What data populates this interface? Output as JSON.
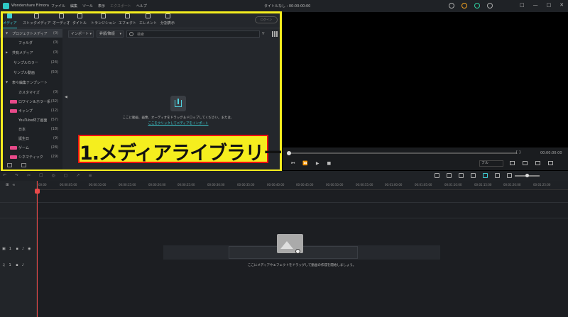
{
  "titlebar": {
    "app_title": "Wondershare Filmora",
    "menu": [
      "ファイル",
      "編集",
      "ツール",
      "表示",
      "エクスポート",
      "ヘルプ"
    ],
    "project": "タイトルなし : 00:00:00:00",
    "window_controls": [
      "—",
      "□",
      "✕"
    ]
  },
  "tabs": [
    {
      "label": "メディア",
      "icon": "media-icon"
    },
    {
      "label": "ストックメディア",
      "icon": "stock-media-icon"
    },
    {
      "label": "オーディオ",
      "icon": "audio-icon"
    },
    {
      "label": "タイトル",
      "icon": "title-icon"
    },
    {
      "label": "トランジション",
      "icon": "transition-icon"
    },
    {
      "label": "エフェクト",
      "icon": "effect-icon"
    },
    {
      "label": "エレメント",
      "icon": "element-icon"
    },
    {
      "label": "分割表示",
      "icon": "split-screen-icon"
    }
  ],
  "login_label": "ログイン",
  "sidebar": {
    "items": [
      {
        "label": "プロジェクトメディア",
        "count": "(0)",
        "caret": "▼",
        "selected": true
      },
      {
        "label": "フォルダ",
        "count": "(0)"
      },
      {
        "label": "共有メディア",
        "count": "(0)",
        "caret": "▶"
      },
      {
        "label": "サンプルカラー",
        "count": "(24)"
      },
      {
        "label": "サンプル動画",
        "count": "(50)"
      },
      {
        "label": "表々編集テンプレート",
        "count": "",
        "caret": "▼"
      },
      {
        "label": "カスタマイズ",
        "count": "(0)"
      },
      {
        "label": "ロワイン＆ホラー系",
        "count": "(32)",
        "badge": true
      },
      {
        "label": "キャンプ",
        "count": "(12)",
        "badge": true
      },
      {
        "label": "YouTube終了画面",
        "count": "(57)"
      },
      {
        "label": "日本",
        "count": "(18)"
      },
      {
        "label": "誕生日",
        "count": "(9)"
      },
      {
        "label": "ゲーム",
        "count": "(28)",
        "badge": true
      },
      {
        "label": "シネマティック",
        "count": "(29)",
        "badge": true
      }
    ]
  },
  "toolbar": {
    "import_label": "インポート",
    "sort_label": "昇順/降順",
    "search_placeholder": "検索"
  },
  "dropzone": {
    "text": "ここに動画、画像、オーディオをドラッグ＆ドロップしてください。または、",
    "link": "ここをクリックしてメディアをインポート"
  },
  "caption": "1.メディアライブラリー",
  "preview": {
    "braces": "{   }",
    "time": "00:00:00:00",
    "zoom": "フル",
    "buttons": [
      "⏮",
      "⏪",
      "▶",
      "■"
    ]
  },
  "timeline": {
    "left_tools": [
      "↶",
      "↷",
      "✂",
      "☐",
      "◎",
      "▢",
      "↗",
      "≡"
    ],
    "ruler_ticks": [
      "00:00",
      "00:00:05:00",
      "00:00:10:00",
      "00:00:15:00",
      "00:00:20:00",
      "00:00:25:00",
      "00:00:30:00",
      "00:00:35:00",
      "00:00:40:00",
      "00:00:45:00",
      "00:00:50:00",
      "00:00:55:00",
      "00:01:00:00",
      "00:01:05:00",
      "00:01:10:00",
      "00:01:15:00",
      "00:01:20:00",
      "00:01:25:00"
    ],
    "video_track": "1",
    "audio_track": "1",
    "drop_text": "ここにメディアやエフェクトをドラッグして動画の作成を開始しましょう。"
  },
  "colors": {
    "accent": "#3fd0d6",
    "highlight": "#f5ee1e",
    "playhead": "#e84a4a"
  }
}
